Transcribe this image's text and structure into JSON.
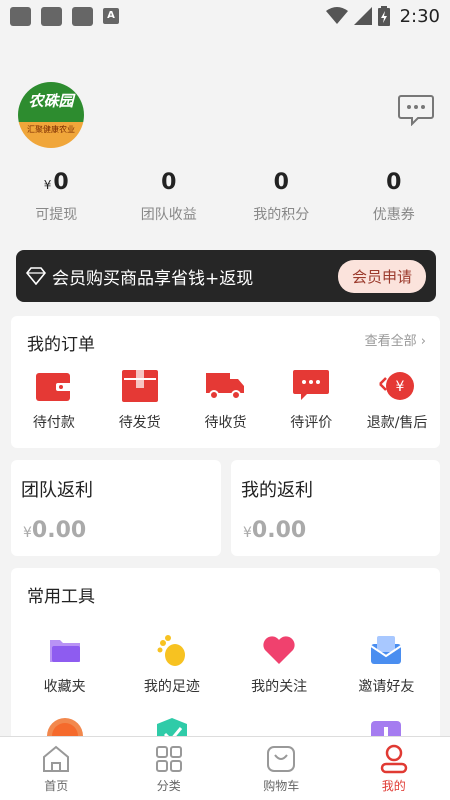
{
  "status_bar": {
    "time": "2:30",
    "a_glyph": "A"
  },
  "header": {
    "logo_title": "农硃园",
    "logo_subtitle": "汇聚健康农业"
  },
  "stats": [
    {
      "value": "0",
      "currency": "¥",
      "label": "可提现"
    },
    {
      "value": "0",
      "label": "团队收益"
    },
    {
      "value": "0",
      "label": "我的积分"
    },
    {
      "value": "0",
      "label": "优惠券"
    }
  ],
  "member_banner": {
    "text": "会员购买商品享省钱+返现",
    "button": "会员申请"
  },
  "orders": {
    "title": "我的订单",
    "view_all": "查看全部",
    "items": [
      {
        "label": "待付款",
        "icon": "wallet-icon"
      },
      {
        "label": "待发货",
        "icon": "package-icon"
      },
      {
        "label": "待收货",
        "icon": "truck-icon"
      },
      {
        "label": "待评价",
        "icon": "comment-icon"
      },
      {
        "label": "退款/售后",
        "icon": "refund-icon"
      }
    ]
  },
  "rebates": {
    "team": {
      "title": "团队返利",
      "currency": "¥",
      "value": "0.00"
    },
    "mine": {
      "title": "我的返利",
      "currency": "¥",
      "value": "0.00"
    }
  },
  "tools": {
    "title": "常用工具",
    "items": [
      {
        "label": "收藏夹",
        "icon": "folder-icon"
      },
      {
        "label": "我的足迹",
        "icon": "footprint-icon"
      },
      {
        "label": "我的关注",
        "icon": "heart-icon"
      },
      {
        "label": "邀请好友",
        "icon": "invite-icon"
      }
    ]
  },
  "tabbar": {
    "items": [
      {
        "label": "首页",
        "icon": "home-icon"
      },
      {
        "label": "分类",
        "icon": "grid-icon"
      },
      {
        "label": "购物车",
        "icon": "cart-icon"
      },
      {
        "label": "我的",
        "icon": "profile-icon"
      }
    ]
  },
  "colors": {
    "accent": "#e03a33",
    "banner": "#262626"
  }
}
